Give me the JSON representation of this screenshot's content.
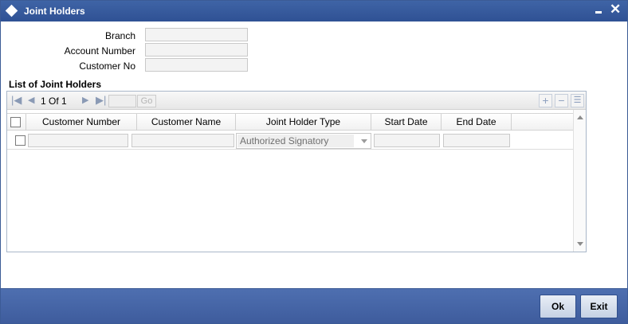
{
  "window": {
    "title": "Joint Holders"
  },
  "form": {
    "branch_label": "Branch",
    "account_number_label": "Account Number",
    "customer_no_label": "Customer No",
    "branch_value": "",
    "account_number_value": "",
    "customer_no_value": ""
  },
  "section": {
    "title": "List of Joint Holders"
  },
  "pager": {
    "current": "1",
    "of_label": "Of",
    "total": "1",
    "go_label": "Go"
  },
  "grid": {
    "columns": [
      "Customer Number",
      "Customer Name",
      "Joint Holder Type",
      "Start Date",
      "End Date"
    ],
    "rows": [
      {
        "customer_number": "",
        "customer_name": "",
        "joint_holder_type": "Authorized Signatory",
        "start_date": "",
        "end_date": ""
      }
    ]
  },
  "footer": {
    "ok_label": "Ok",
    "exit_label": "Exit"
  },
  "colors": {
    "titlebar": "#2f5194",
    "footer": "#4466a8",
    "button_border": "#2f4e8c"
  },
  "icons": {
    "title": "diamond-icon",
    "minimize": "minimize-icon",
    "close": "close-icon",
    "first": "first-page-icon",
    "prev": "prev-page-icon",
    "next": "next-page-icon",
    "last": "last-page-icon",
    "add": "add-row-icon",
    "delete": "delete-row-icon",
    "view": "single-view-icon"
  }
}
